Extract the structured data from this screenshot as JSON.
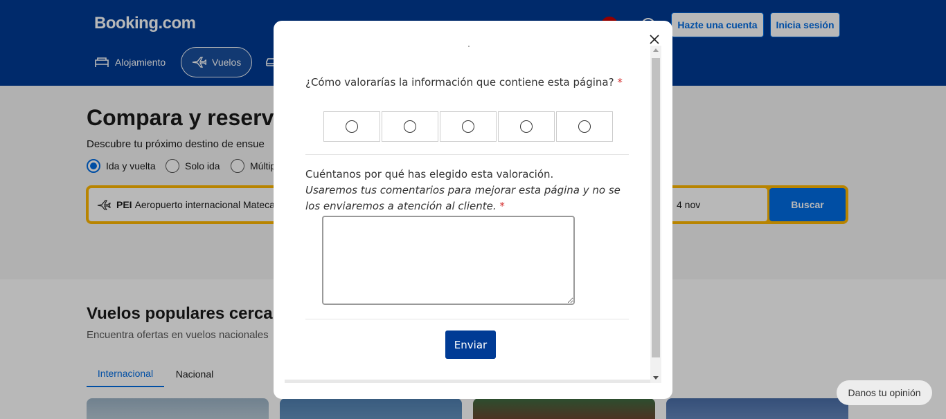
{
  "header": {
    "logo": "Booking.com",
    "signup_label": "Hazte una cuenta",
    "signin_label": "Inicia sesión",
    "nav": [
      {
        "label": "Alojamiento",
        "icon": "bed-icon"
      },
      {
        "label": "Vuelos",
        "icon": "plane-icon",
        "active": true
      },
      {
        "label": "",
        "icon": "car-icon"
      }
    ]
  },
  "hero": {
    "title": "Compara y reserva",
    "subtitle": "Descubre tu próximo destino de ensue",
    "trip_options": [
      "Ida y vuelta",
      "Solo ida",
      "Múltip"
    ],
    "selected_trip": "Ida y vuelta",
    "origin_code": "PEI",
    "origin_name": "Aeropuerto internacional Mateca",
    "date_text": "4 nov",
    "search_label": "Buscar"
  },
  "popular": {
    "title": "Vuelos populares cerca d",
    "subtitle": "Encuentra ofertas en vuelos nacionales",
    "tabs": [
      "Internacional",
      "Nacional"
    ],
    "active_tab": "Internacional"
  },
  "feedback_tab": "Danos tu opinión",
  "modal": {
    "question1": "¿Cómo valorarías la información que contiene esta página?",
    "required_mark": "*",
    "rating_count": 5,
    "question2": "Cuéntanos por qué has elegido esta valoración.",
    "question2_note": "Usaremos tus comentarios para mejorar esta página y no se los enviaremos a atención al cliente.",
    "comment_value": "",
    "send_label": "Enviar"
  },
  "colors": {
    "brand_blue": "#003b95",
    "action_blue": "#006ce4",
    "search_yellow": "#ffb700",
    "required_red": "#d32f2f"
  }
}
